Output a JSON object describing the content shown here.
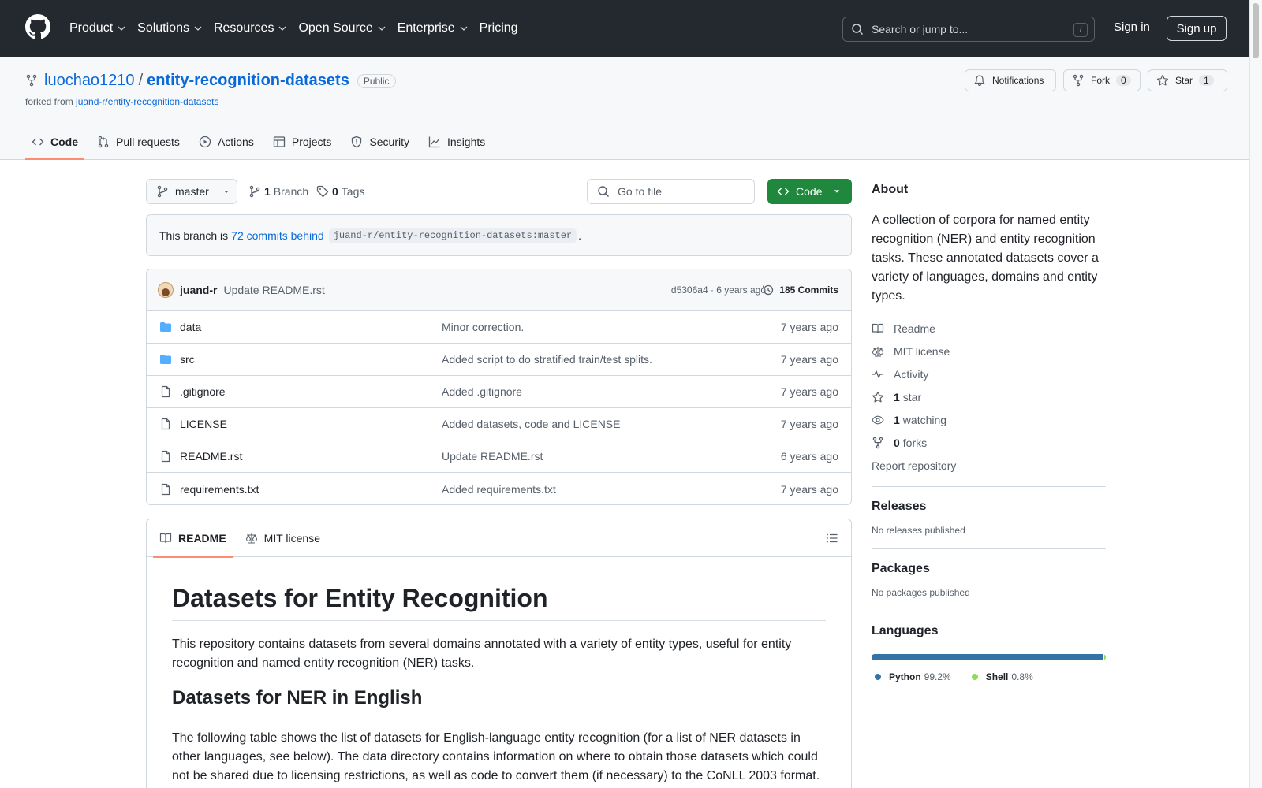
{
  "header": {
    "nav": [
      "Product",
      "Solutions",
      "Resources",
      "Open Source",
      "Enterprise",
      "Pricing"
    ],
    "search_placeholder": "Search or jump to...",
    "search_shortcut": "/",
    "signin": "Sign in",
    "signup": "Sign up"
  },
  "repo": {
    "owner": "luochao1210",
    "separator": "/",
    "name": "entity-recognition-datasets",
    "visibility": "Public",
    "forked_prefix": "forked from",
    "forked_from": "juand-r/entity-recognition-datasets",
    "notifications": "Notifications",
    "fork_label": "Fork",
    "fork_count": "0",
    "star_label": "Star",
    "star_count": "1"
  },
  "tabs": [
    "Code",
    "Pull requests",
    "Actions",
    "Projects",
    "Security",
    "Insights"
  ],
  "toolbar": {
    "branch": "master",
    "branch_count": "1",
    "branch_label": "Branch",
    "tag_count": "0",
    "tag_label": "Tags",
    "goto_placeholder": "Go to file",
    "code_button": "Code"
  },
  "behind": {
    "prefix": "This branch is",
    "link": "72 commits behind",
    "ref": "juand-r/entity-recognition-datasets:master",
    "suffix": "."
  },
  "commit": {
    "author": "juand-r",
    "message": "Update README.rst",
    "meta": "d5306a4 · 6 years ago",
    "count": "185 Commits"
  },
  "files": [
    {
      "name": "data",
      "type": "folder",
      "message": "Minor correction.",
      "date": "7 years ago"
    },
    {
      "name": "src",
      "type": "folder",
      "message": "Added script to do stratified train/test splits.",
      "date": "7 years ago"
    },
    {
      "name": ".gitignore",
      "type": "file",
      "message": "Added .gitignore",
      "date": "7 years ago"
    },
    {
      "name": "LICENSE",
      "type": "file",
      "message": "Added datasets, code and LICENSE",
      "date": "7 years ago"
    },
    {
      "name": "README.rst",
      "type": "file",
      "message": "Update README.rst",
      "date": "6 years ago"
    },
    {
      "name": "requirements.txt",
      "type": "file",
      "message": "Added requirements.txt",
      "date": "7 years ago"
    }
  ],
  "readme": {
    "tab_readme": "README",
    "tab_license": "MIT license",
    "h1": "Datasets for Entity Recognition",
    "p1": "This repository contains datasets from several domains annotated with a variety of entity types, useful for entity recognition and named entity recognition (NER) tasks.",
    "h2": "Datasets for NER in English",
    "p2": "The following table shows the list of datasets for English-language entity recognition (for a list of NER datasets in other languages, see below). The data directory contains information on where to obtain those datasets which could not be shared due to licensing restrictions, as well as code to convert them (if necessary) to the CoNLL 2003 format."
  },
  "sidebar": {
    "about_title": "About",
    "about_text": "A collection of corpora for named entity recognition (NER) and entity recognition tasks. These annotated datasets cover a variety of languages, domains and entity types.",
    "links": {
      "readme": "Readme",
      "license": "MIT license",
      "activity": "Activity",
      "stars_count": "1",
      "stars_label": "star",
      "watching_count": "1",
      "watching_label": "watching",
      "forks_count": "0",
      "forks_label": "forks"
    },
    "report": "Report repository",
    "releases_title": "Releases",
    "releases_text": "No releases published",
    "packages_title": "Packages",
    "packages_text": "No packages published",
    "languages_title": "Languages",
    "languages": [
      {
        "name": "Python",
        "percent": "99.2%",
        "value": 99.2,
        "color": "#3572A5"
      },
      {
        "name": "Shell",
        "percent": "0.8%",
        "value": 0.8,
        "color": "#89e051"
      }
    ]
  }
}
